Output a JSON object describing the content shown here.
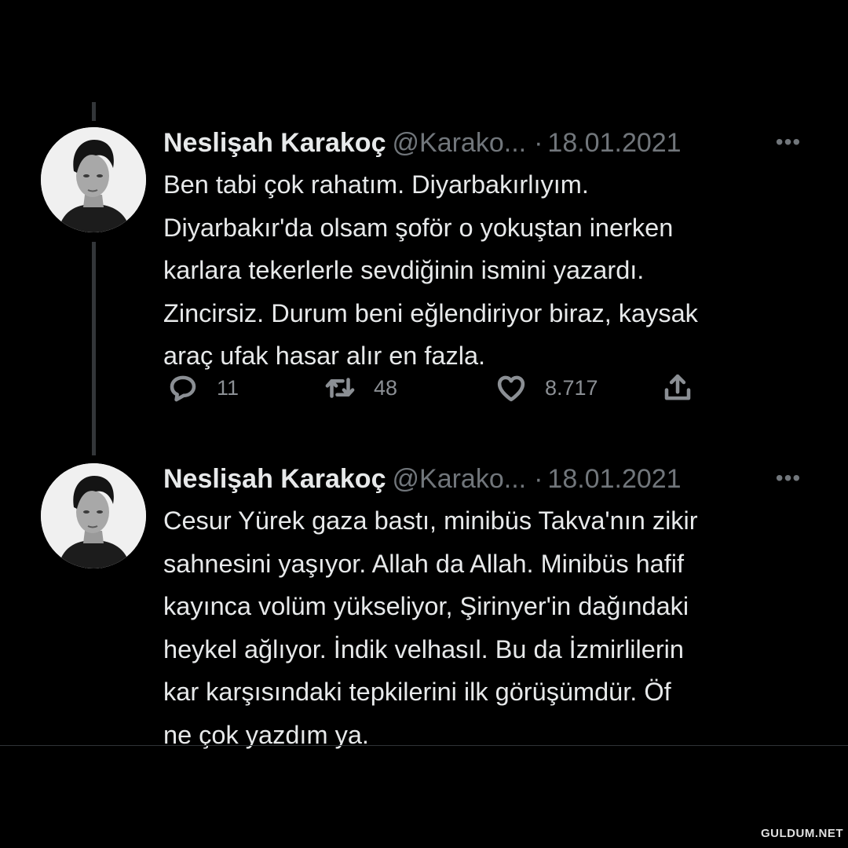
{
  "tweets": [
    {
      "author_name": "Neslişah Karakoç",
      "author_handle": "@Karako...",
      "separator": "·",
      "date": "18.01.2021",
      "more_icon": "more-icon",
      "text": "Ben tabi çok rahatım. Diyarbakırlıyım.\nDiyarbakır'da olsam şoför o yokuştan inerken\nkarlara tekerlerle sevdiğinin ismini yazardı.\nZincirsiz. Durum beni eğlendiriyor biraz, kaysak\naraç ufak hasar alır en fazla.",
      "replies": "11",
      "retweets": "48",
      "likes": "8.717"
    },
    {
      "author_name": "Neslişah Karakoç",
      "author_handle": "@Karako...",
      "separator": "·",
      "date": "18.01.2021",
      "more_icon": "more-icon",
      "text": "Cesur Yürek gaza bastı, minibüs Takva'nın zikir\nsahnesini yaşıyor.  Allah da Allah. Minibüs hafif\nkayınca volüm yükseliyor, Şirinyer'in dağındaki\nheykel ağlıyor. İndik velhasıl. Bu da İzmirlilerin\nkar karşısındaki tepkilerini ilk görüşümdür. Öf\nne çok yazdım ya."
    }
  ],
  "icons": [
    "reply-icon",
    "retweet-icon",
    "like-icon",
    "share-icon"
  ],
  "colors": {
    "background": "#000000",
    "text": "#e7e9ea",
    "secondary_text": "#71767b",
    "thread_line": "#333639"
  },
  "watermark": "GULDUM.NET"
}
